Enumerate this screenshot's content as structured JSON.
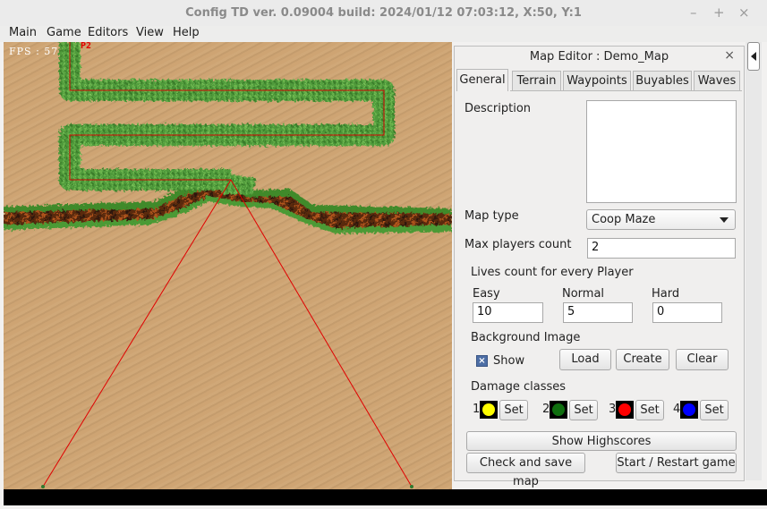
{
  "window": {
    "title": "Config TD ver. 0.09004 build: 2024/01/12  07:03:12, X:50, Y:1",
    "minimize_glyph": "–",
    "maximize_glyph": "+",
    "close_glyph": "×"
  },
  "menu": [
    "Main",
    "Game",
    "Editors",
    "View",
    "Help"
  ],
  "game": {
    "fps_label": "FPS : 57",
    "player_tag": "P2"
  },
  "editor": {
    "title": "Map Editor : Demo_Map",
    "close_glyph": "×",
    "tabs": [
      "General",
      "Terrain",
      "Waypoints",
      "Buyables",
      "Waves"
    ],
    "active_tab": "General",
    "description_label": "Description",
    "description_value": "",
    "map_type_label": "Map type",
    "map_type_value": "Coop Maze",
    "max_players_label": "Max players count",
    "max_players_value": "2",
    "lives_label": "Lives count for every Player",
    "lives": [
      {
        "label": "Easy",
        "value": "10"
      },
      {
        "label": "Normal",
        "value": "5"
      },
      {
        "label": "Hard",
        "value": "0"
      }
    ],
    "background_label": "Background Image",
    "show_label": "Show",
    "show_checked": true,
    "load_label": "Load",
    "create_label": "Create",
    "clear_label": "Clear",
    "damage_label": "Damage classes",
    "damage_classes": [
      {
        "num": "1",
        "color": "#ffff00",
        "set_label": "Set"
      },
      {
        "num": "2",
        "color": "#0f6e0f",
        "set_label": "Set"
      },
      {
        "num": "3",
        "color": "#ff0000",
        "set_label": "Set"
      },
      {
        "num": "4",
        "color": "#0000ff",
        "set_label": "Set"
      }
    ],
    "highscores_label": "Show Highscores",
    "check_save_label": "Check and save map",
    "start_label": "Start / Restart game"
  },
  "colors": {
    "sand": "#cea473",
    "grass": "#4f9a3a",
    "path_line": "#d40000",
    "tab_highlight": "#4d6ea5"
  }
}
